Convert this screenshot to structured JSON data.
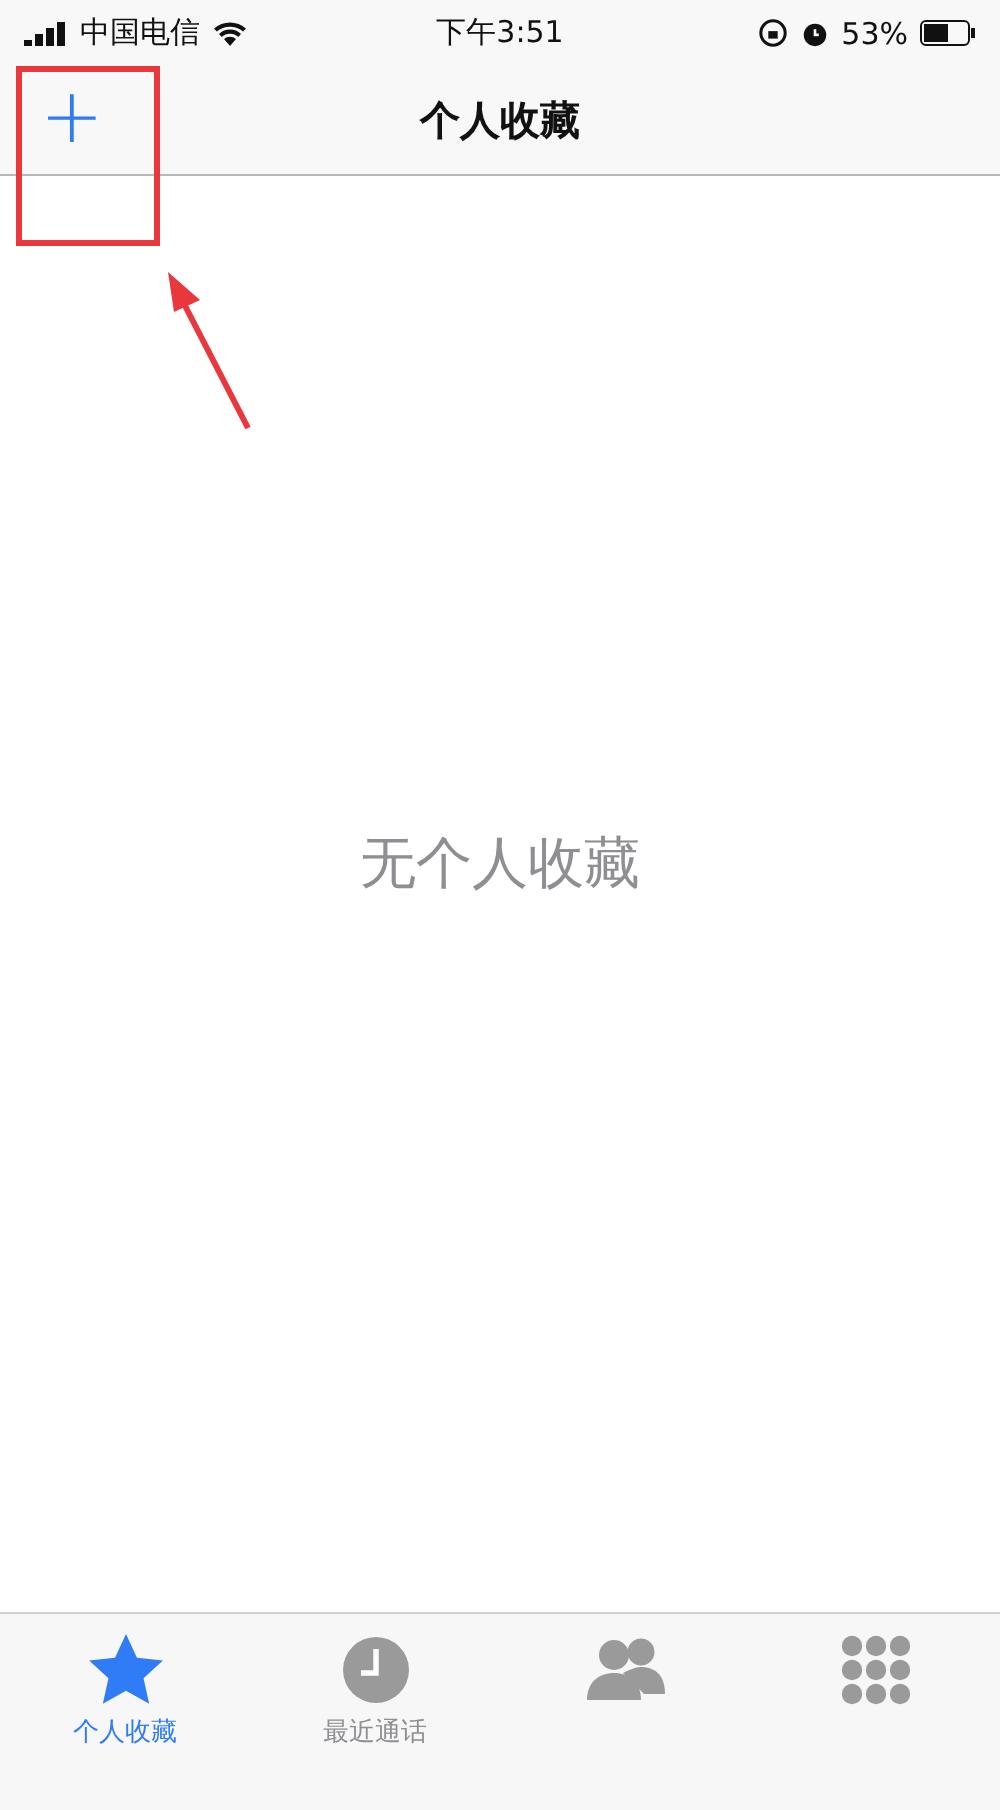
{
  "status_bar": {
    "carrier": "中国电信",
    "time": "下午3:51",
    "battery": "53%"
  },
  "nav_bar": {
    "add_button": "+",
    "title": "个人收藏"
  },
  "empty_message": "无个人收藏",
  "tab_bar": [
    {
      "kind": "star",
      "label": "个人收藏",
      "selected": true
    },
    {
      "kind": "clock",
      "label": "最近通话",
      "selected": false
    },
    {
      "kind": "people",
      "selected": false
    },
    {
      "kind": "keypad",
      "selected": false
    }
  ]
}
